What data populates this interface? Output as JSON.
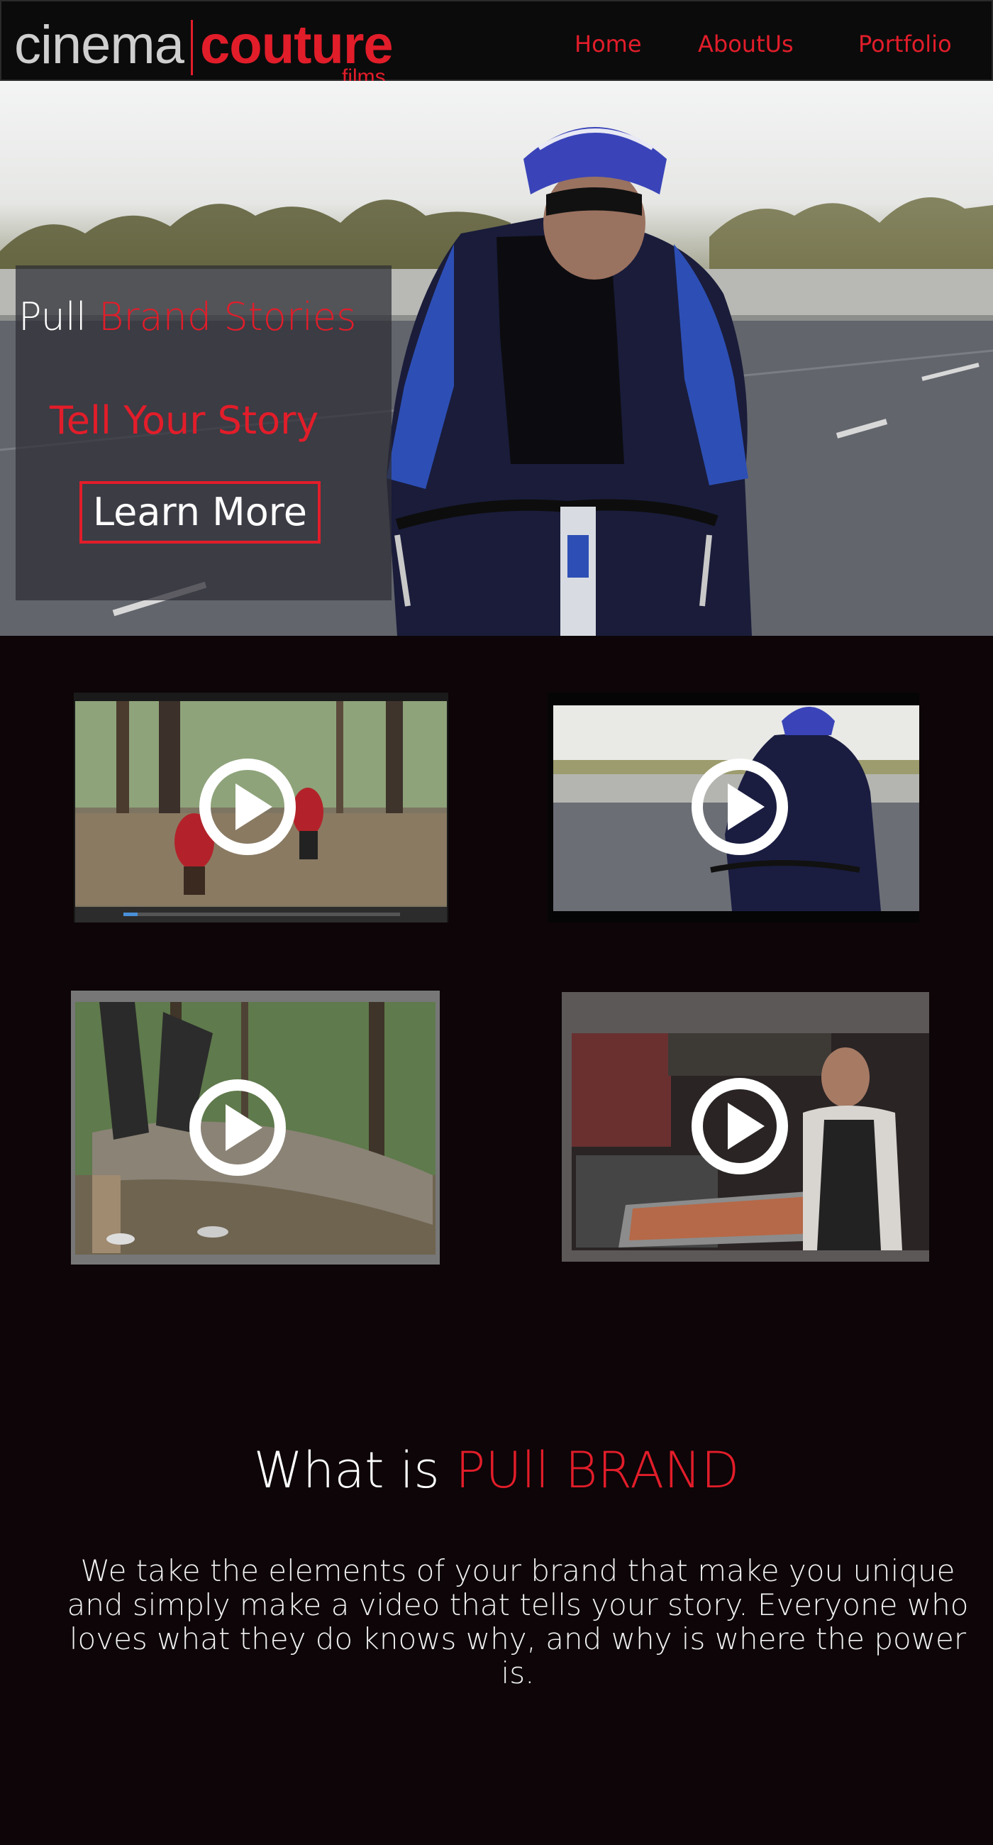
{
  "header": {
    "logo": {
      "cinema": "cinema",
      "couture": "couture",
      "films": "films"
    },
    "nav": [
      {
        "label": "Home"
      },
      {
        "label": "AboutUs"
      },
      {
        "label": "Portfolio"
      }
    ]
  },
  "hero": {
    "title_prefix": "Pull",
    "title_accent": "Brand Stories",
    "subtitle": "Tell Your Story",
    "button_label": "Learn More"
  },
  "videos": [
    {
      "name": "video-forest-runners",
      "icon": "play-icon"
    },
    {
      "name": "video-cyclist",
      "icon": "play-icon"
    },
    {
      "name": "video-log-obstacle",
      "icon": "play-icon"
    },
    {
      "name": "video-chef-kitchen",
      "icon": "play-icon"
    }
  ],
  "about": {
    "heading_prefix": "What is",
    "heading_accent": "PUll BRAND",
    "body": "We take the elements of your brand that make you unique and simply make a video that tells your story. Everyone who loves what they do knows why, and why is where the power is."
  },
  "colors": {
    "accent": "#e21d2a",
    "page_background": "#0d0507",
    "header_background": "#0b0b0b"
  }
}
